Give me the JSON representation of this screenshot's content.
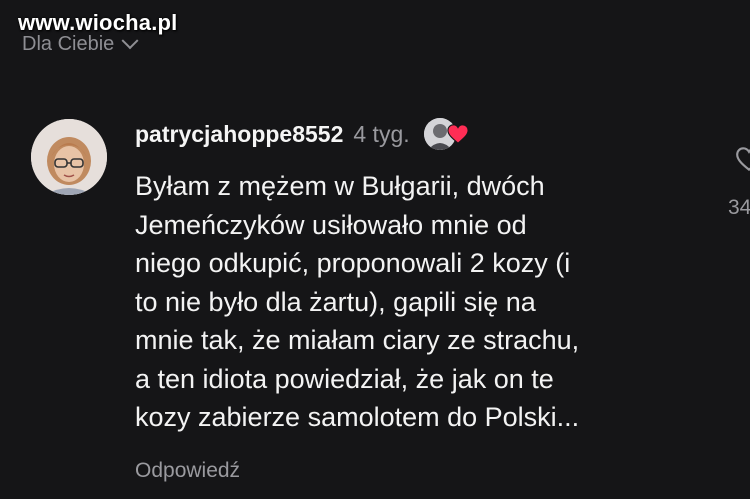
{
  "watermark": "www.wiocha.pl",
  "feed": {
    "label": "Dla Ciebie"
  },
  "comment": {
    "username": "patrycjahoppe8552",
    "time": "4 tyg.",
    "body_lines": [
      "Byłam z mężem w Bułgarii, dwóch",
      "Jemeńczyków usiłowało mnie od",
      "niego odkupić, proponowali 2 kozy (i",
      "to nie było dla żartu), gapili się na",
      "mnie tak, że miałam ciary ze strachu,",
      "a ten idiota powiedział, że jak on te",
      "kozy zabierze samolotem do Polski..."
    ],
    "reply_label": "Odpowiedź",
    "like_count_partial": "34",
    "creator_liked_icon": "heart-icon",
    "accent_heart": "#ff2d55"
  },
  "colors": {
    "background": "#151517",
    "text_primary": "#f3f3f3",
    "text_secondary": "#9a9a9f"
  }
}
